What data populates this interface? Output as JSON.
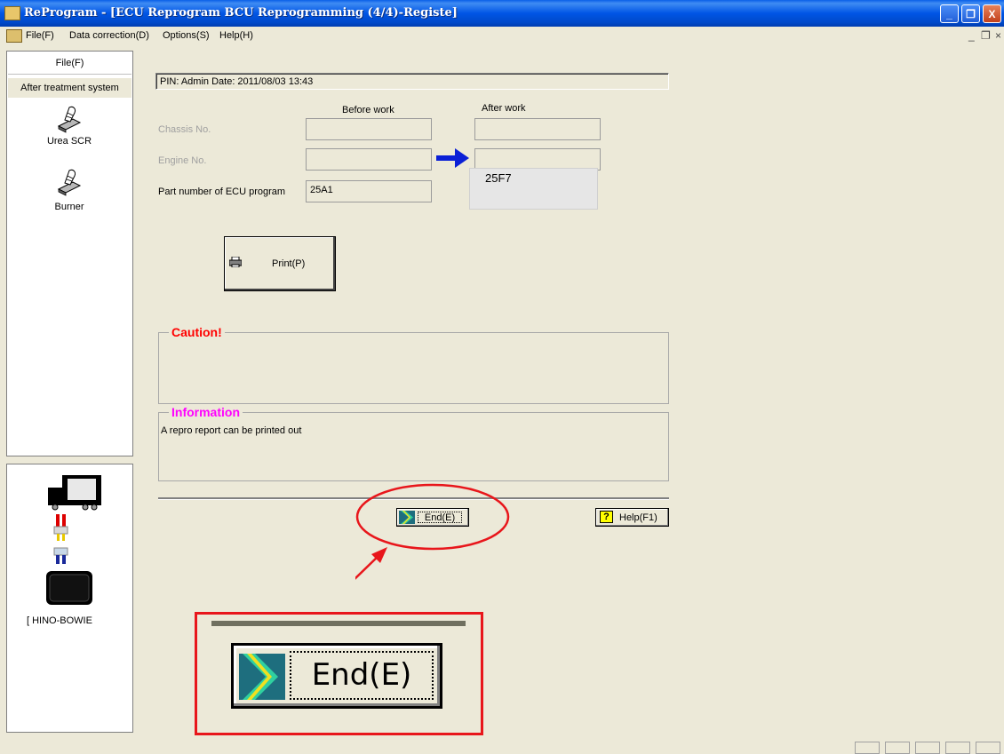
{
  "window": {
    "title": "ReProgram - [ECU Reprogram BCU Reprogramming (4/4)-Registe]",
    "min_label": "_",
    "max_label": "❐",
    "close_label": "X"
  },
  "menu": {
    "items": [
      "File(F)",
      "Data correction(D)",
      "Options(S)",
      "Help(H)"
    ],
    "mdi_min": "_",
    "mdi_restore": "❐",
    "mdi_close": "×"
  },
  "sidebar": {
    "header": "File(F)",
    "section": "After treatment system",
    "tools": [
      {
        "label": "Urea SCR",
        "icon": "hand-tool-icon"
      },
      {
        "label": "Burner",
        "icon": "hand-tool-icon"
      }
    ],
    "device_label": "[ HINO-BOWIE"
  },
  "main": {
    "pin_line": "PIN: Admin  Date: 2011/08/03 13:43",
    "col_before": "Before work",
    "col_after": "After work",
    "rows": [
      {
        "label": "Chassis No.",
        "before": "",
        "after": ""
      },
      {
        "label": "Engine No.",
        "before": "",
        "after": ""
      },
      {
        "label": "Part number of ECU program",
        "before": "25A1",
        "after": "25F7"
      }
    ],
    "print_label": "Print(P)",
    "caution_title": "Caution!",
    "caution_text": "",
    "info_title": "Information",
    "info_text": "A repro report can be printed out",
    "end_label": "End(E)",
    "help_label": "Help(F1)",
    "help_icon_text": "?",
    "zoom_end_label": "End(E)"
  },
  "colors": {
    "caution": "#ff0000",
    "information": "#ff00ff",
    "annotation": "#e8161b",
    "arrow": "#0a1fd6"
  }
}
